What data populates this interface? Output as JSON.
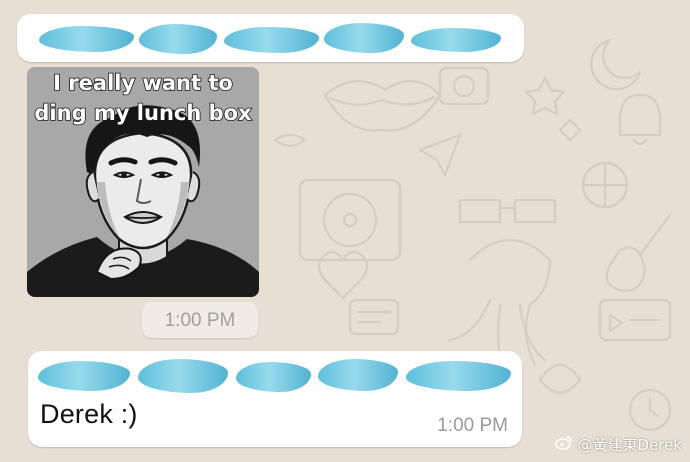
{
  "chat": {
    "messages": [
      {
        "id": "top-redacted-message",
        "content_hidden": true
      },
      {
        "id": "sticker-message",
        "sticker_caption_lines": [
          "I really want to",
          "ding my lunch box"
        ],
        "time": "1:00 PM"
      },
      {
        "id": "derek-message",
        "text": "Derek :)",
        "time": "1:00 PM",
        "redacted_quote": true
      }
    ]
  },
  "watermark": {
    "text": "@黃建東Derek",
    "icon": "weibo-icon"
  },
  "colors": {
    "wallpaper": "#e7dfd3",
    "wallpaper_doodle": "#d8d0c4",
    "bubble": "#ffffff",
    "redaction": "#47b6d6",
    "timestamp": "#9a9a9a"
  }
}
